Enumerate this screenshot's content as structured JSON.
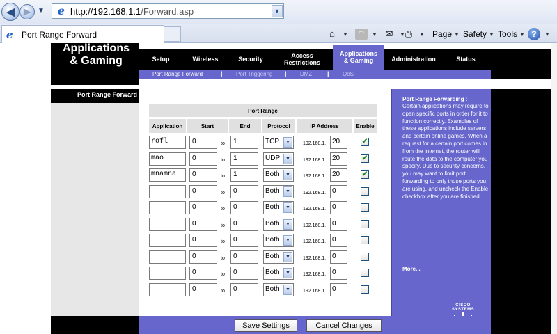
{
  "browser": {
    "address_host": "http://192.168.1.1",
    "address_path": "/Forward.asp",
    "tab_title": "Port Range Forward",
    "commands": {
      "page": "Page",
      "safety": "Safety",
      "tools": "Tools"
    }
  },
  "router": {
    "brand_title_line1": "Applications",
    "brand_title_line2": "& Gaming",
    "nav": [
      {
        "label": "Setup"
      },
      {
        "label": "Wireless"
      },
      {
        "label": "Security"
      },
      {
        "label": "Access Restrictions"
      },
      {
        "label": "Applications & Gaming"
      },
      {
        "label": "Administration"
      },
      {
        "label": "Status"
      }
    ],
    "subnav": [
      {
        "label": "Port Range Forward"
      },
      {
        "label": "Port Triggering"
      },
      {
        "label": "DMZ"
      },
      {
        "label": "QoS"
      }
    ],
    "section_label": "Port Range Forward"
  },
  "table": {
    "group_header": "Port Range",
    "headers": {
      "application": "Application",
      "start": "Start",
      "end": "End",
      "protocol": "Protocol",
      "ip": "IP Address",
      "enable": "Enable"
    },
    "to_label": "to",
    "ip_prefix": "192.168.1.",
    "rows": [
      {
        "app": "rofl",
        "start": "0",
        "end": "1",
        "protocol": "TCP",
        "ip": "20",
        "enabled": true
      },
      {
        "app": "mao",
        "start": "0",
        "end": "1",
        "protocol": "UDP",
        "ip": "20",
        "enabled": true
      },
      {
        "app": "mnamna",
        "start": "0",
        "end": "1",
        "protocol": "Both",
        "ip": "20",
        "enabled": true
      },
      {
        "app": "",
        "start": "0",
        "end": "0",
        "protocol": "Both",
        "ip": "0",
        "enabled": false
      },
      {
        "app": "",
        "start": "0",
        "end": "0",
        "protocol": "Both",
        "ip": "0",
        "enabled": false
      },
      {
        "app": "",
        "start": "0",
        "end": "0",
        "protocol": "Both",
        "ip": "0",
        "enabled": false
      },
      {
        "app": "",
        "start": "0",
        "end": "0",
        "protocol": "Both",
        "ip": "0",
        "enabled": false
      },
      {
        "app": "",
        "start": "0",
        "end": "0",
        "protocol": "Both",
        "ip": "0",
        "enabled": false
      },
      {
        "app": "",
        "start": "0",
        "end": "0",
        "protocol": "Both",
        "ip": "0",
        "enabled": false
      },
      {
        "app": "",
        "start": "0",
        "end": "0",
        "protocol": "Both",
        "ip": "0",
        "enabled": false
      }
    ]
  },
  "help": {
    "title": "Port Range Forwarding :",
    "body": "Certain applications may require to open specific ports in order for it to function correctly. Examples of these applications include servers and certain online games. When a request for a certain port comes in from the Internet, the router will route the data to the computer you specify. Due to security concerns, you may want to limit port forwarding to only those ports you are using, and uncheck the Enable checkbox after you are finished.",
    "more": "More...",
    "logo_text": "CISCO SYSTEMS"
  },
  "buttons": {
    "save": "Save Settings",
    "cancel": "Cancel Changes"
  },
  "colors": {
    "accent": "#6666cc",
    "nav_bg": "#000000",
    "panel_gray": "#e7e7e7"
  }
}
